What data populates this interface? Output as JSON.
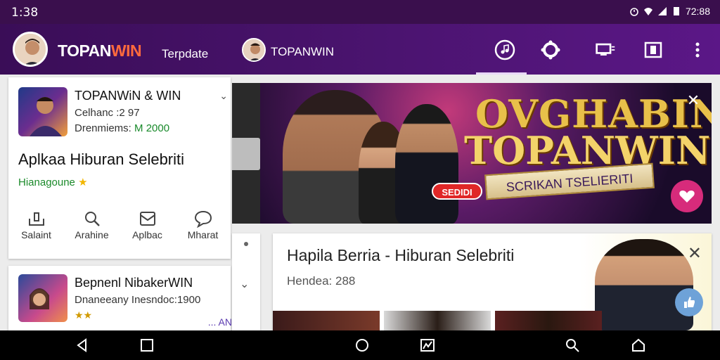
{
  "status_bar": {
    "time": "1:38",
    "right_text": "72:88",
    "icons": [
      "alarm-icon",
      "wifi-icon",
      "signal-icon",
      "battery-icon"
    ]
  },
  "app_bar": {
    "brand_prefix": "TOPAN",
    "brand_suffix": "WIN",
    "subtitle": "Terpdate",
    "channel": "TOPANWIN",
    "icons": [
      "music-icon",
      "settings-icon",
      "cast-icon",
      "apps-icon",
      "more-vert-icon"
    ],
    "accent": "#ff6a3d"
  },
  "card1": {
    "title": "TOPANWiN & WIN",
    "line1": "Celhanc  :2 97",
    "line2_label": "Drenmiems:",
    "line2_value": "M 2000",
    "headline": "Aplkaa Hiburan Selebriti",
    "tag": "Hianagoune",
    "tag_star": "★",
    "actions": [
      {
        "label": "Salaint",
        "icon": "share-icon"
      },
      {
        "label": "Arahine",
        "icon": "search-icon"
      },
      {
        "label": "Aplbac",
        "icon": "inbox-icon"
      },
      {
        "label": "Mharat",
        "icon": "chat-icon"
      }
    ]
  },
  "card2": {
    "title": "Bepnenl NibakerWIN",
    "subtitle": "Dnaneeany Inesndoc:1900",
    "stars": "★★",
    "more": "... AN"
  },
  "banner": {
    "title_line1": "OVGHABIN",
    "title_line2": "TOPANWIN",
    "ribbon": "SCRIKAN TSELIERITI",
    "pill": "SEDIDI",
    "brand_color": "#d72b7b"
  },
  "card3": {
    "title": "Hapila Berria - Hiburan Selebriti",
    "subtitle": "Hendea: 288"
  },
  "nav_bar": {
    "icons": [
      "back-icon",
      "recents-icon",
      "home-circle-icon",
      "gallery-icon",
      "search-nav-icon",
      "home-nav-icon"
    ]
  }
}
